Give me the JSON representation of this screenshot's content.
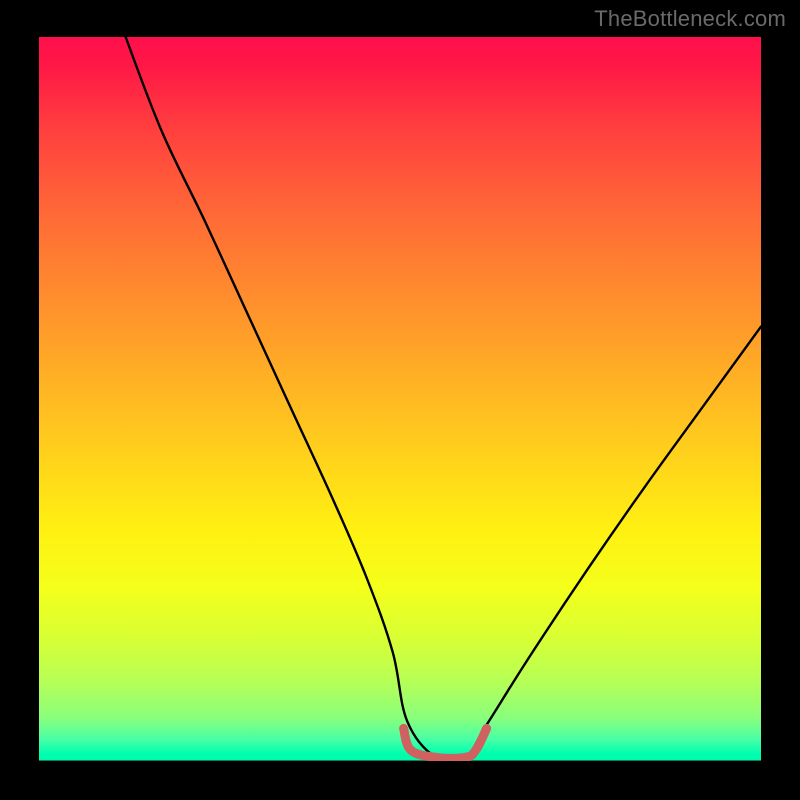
{
  "watermark": "TheBottleneck.com",
  "chart_data": {
    "type": "line",
    "title": "",
    "xlabel": "",
    "ylabel": "",
    "xlim": [
      0,
      100
    ],
    "ylim": [
      0,
      100
    ],
    "series": [
      {
        "name": "bottleneck-curve",
        "x": [
          12,
          17,
          23,
          29,
          35,
          41,
          45.5,
          49,
          51,
          55,
          59,
          62,
          68,
          76,
          84,
          92,
          100
        ],
        "values": [
          100,
          87,
          74.5,
          61.5,
          48.5,
          35.5,
          25,
          15,
          5.5,
          0.5,
          0.5,
          5,
          14.5,
          26.5,
          38,
          49,
          60
        ],
        "color": "#000000"
      },
      {
        "name": "optimal-zone",
        "x": [
          50.5,
          51.5,
          55,
          59,
          60.5,
          62
        ],
        "values": [
          4.5,
          1.5,
          0.5,
          0.5,
          1.5,
          4.5
        ],
        "color": "#cf6161"
      }
    ],
    "background_gradient": [
      "#ff0f4d",
      "#ff6b36",
      "#ffc91e",
      "#d8ff34",
      "#00ffb0"
    ],
    "legend": false,
    "grid": false
  }
}
